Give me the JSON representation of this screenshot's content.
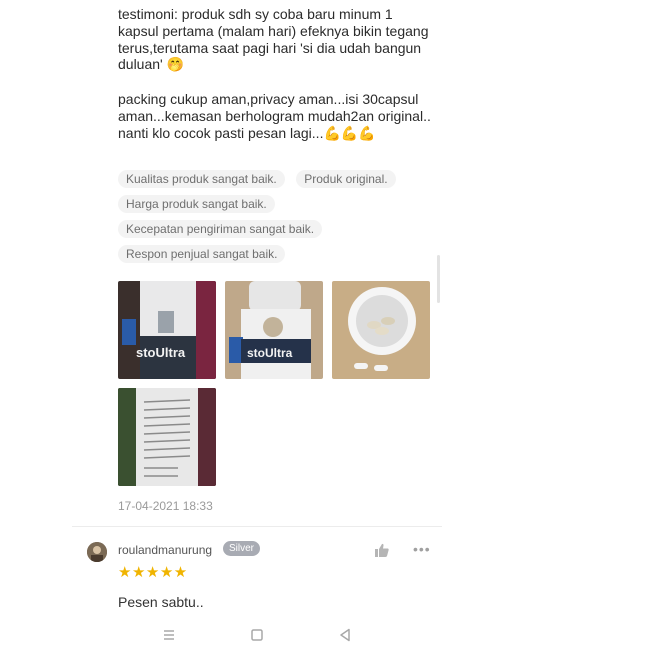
{
  "review": {
    "paragraph1": "testimoni: produk sdh sy coba baru minum 1 kapsul pertama (malam hari) efeknya bikin tegang terus,terutama saat pagi hari 'si dia udah bangun duluan'",
    "paragraph1_emoji": "🤭",
    "paragraph2": "packing cukup aman,privacy aman...isi 30capsul aman...kemasan berhologram mudah2an original..\nnanti klo cocok pasti pesan lagi...",
    "paragraph2_emoji": "💪💪💪",
    "tags": [
      "Kualitas produk sangat baik.",
      "Produk original.",
      "Harga produk sangat baik.",
      "Kecepatan pengiriman sangat baik.",
      "Respon penjual sangat baik."
    ],
    "photos": [
      {
        "icon": "product-bottle-front-photo",
        "label": "stoUltra"
      },
      {
        "icon": "product-bottle-side-photo",
        "label": "stoUltra"
      },
      {
        "icon": "open-bottle-capsules-photo",
        "label": ""
      },
      {
        "icon": "bottle-back-label-photo",
        "label": ""
      }
    ],
    "timestamp": "17-04-2021 18:33"
  },
  "next_review": {
    "username": "roulandmanurung",
    "badge": "Silver",
    "stars": "★★★★★",
    "rating": 5,
    "text": "Pesen sabtu..",
    "avatar_icon": "user-avatar-icon",
    "like_icon": "thumbs-up-icon",
    "more_label": "•••"
  },
  "colors": {
    "star": "#f0b400",
    "badge": "#a8abb3",
    "chip_bg": "#f3f3f3"
  }
}
